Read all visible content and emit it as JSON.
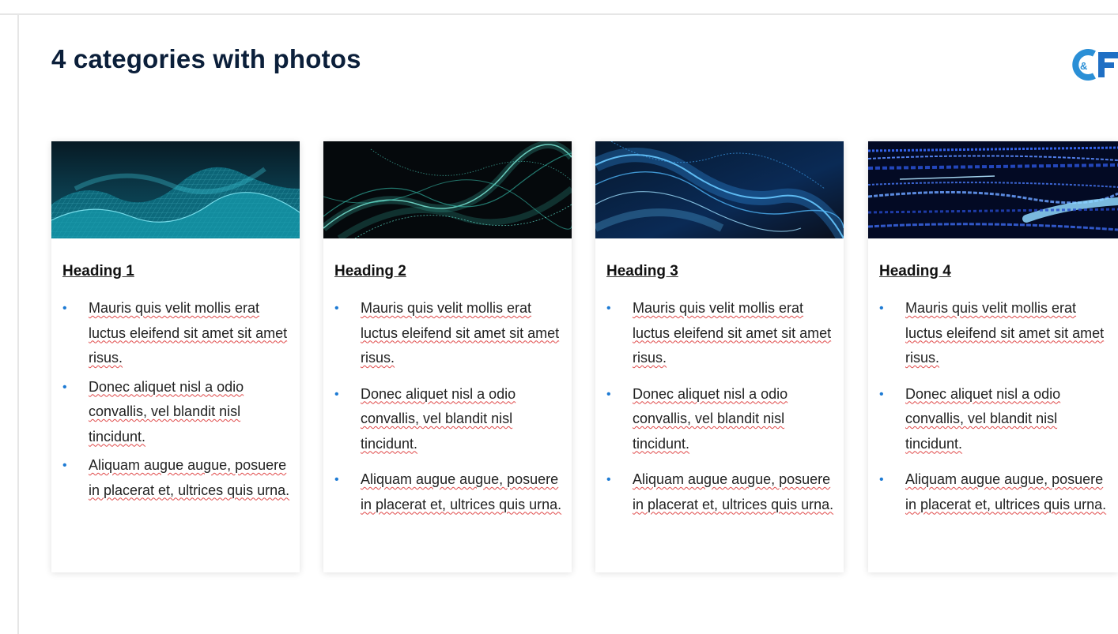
{
  "slide": {
    "title": "4 categories with photos",
    "logo_text": "CF",
    "logo_amp": "&"
  },
  "colors": {
    "title": "#0b1f3a",
    "accent_blue": "#1e7bd4",
    "logo_blue": "#2a8fd6"
  },
  "cards": [
    {
      "heading": "Heading 1",
      "photo": "teal-wave-mesh-photo",
      "bullets": [
        "Mauris quis velit mollis erat luctus eleifend sit amet sit amet risus.",
        "Donec aliquet nisl a odio convallis, vel blandit nisl tincidunt.",
        "Aliquam augue augue, posuere in placerat et, ultrices quis urna."
      ]
    },
    {
      "heading": "Heading 2",
      "photo": "green-particle-wave-photo",
      "bullets": [
        "Mauris quis velit mollis erat luctus eleifend sit amet sit amet risus.",
        "Donec aliquet nisl a odio convallis, vel blandit nisl tincidunt.",
        "Aliquam augue augue, posuere in placerat et, ultrices quis urna."
      ]
    },
    {
      "heading": "Heading 3",
      "photo": "blue-wave-lines-photo",
      "bullets": [
        "Mauris quis velit mollis erat luctus eleifend sit amet sit amet risus.",
        "Donec aliquet nisl a odio convallis, vel blandit nisl tincidunt.",
        "Aliquam augue augue, posuere in placerat et, ultrices quis urna."
      ]
    },
    {
      "heading": "Heading 4",
      "photo": "blue-light-streaks-photo",
      "bullets": [
        "Mauris quis velit mollis erat luctus eleifend sit amet sit amet risus.",
        "Donec aliquet nisl a odio convallis, vel blandit nisl tincidunt.",
        "Aliquam augue augue, posuere in placerat et, ultrices quis urna."
      ]
    }
  ]
}
